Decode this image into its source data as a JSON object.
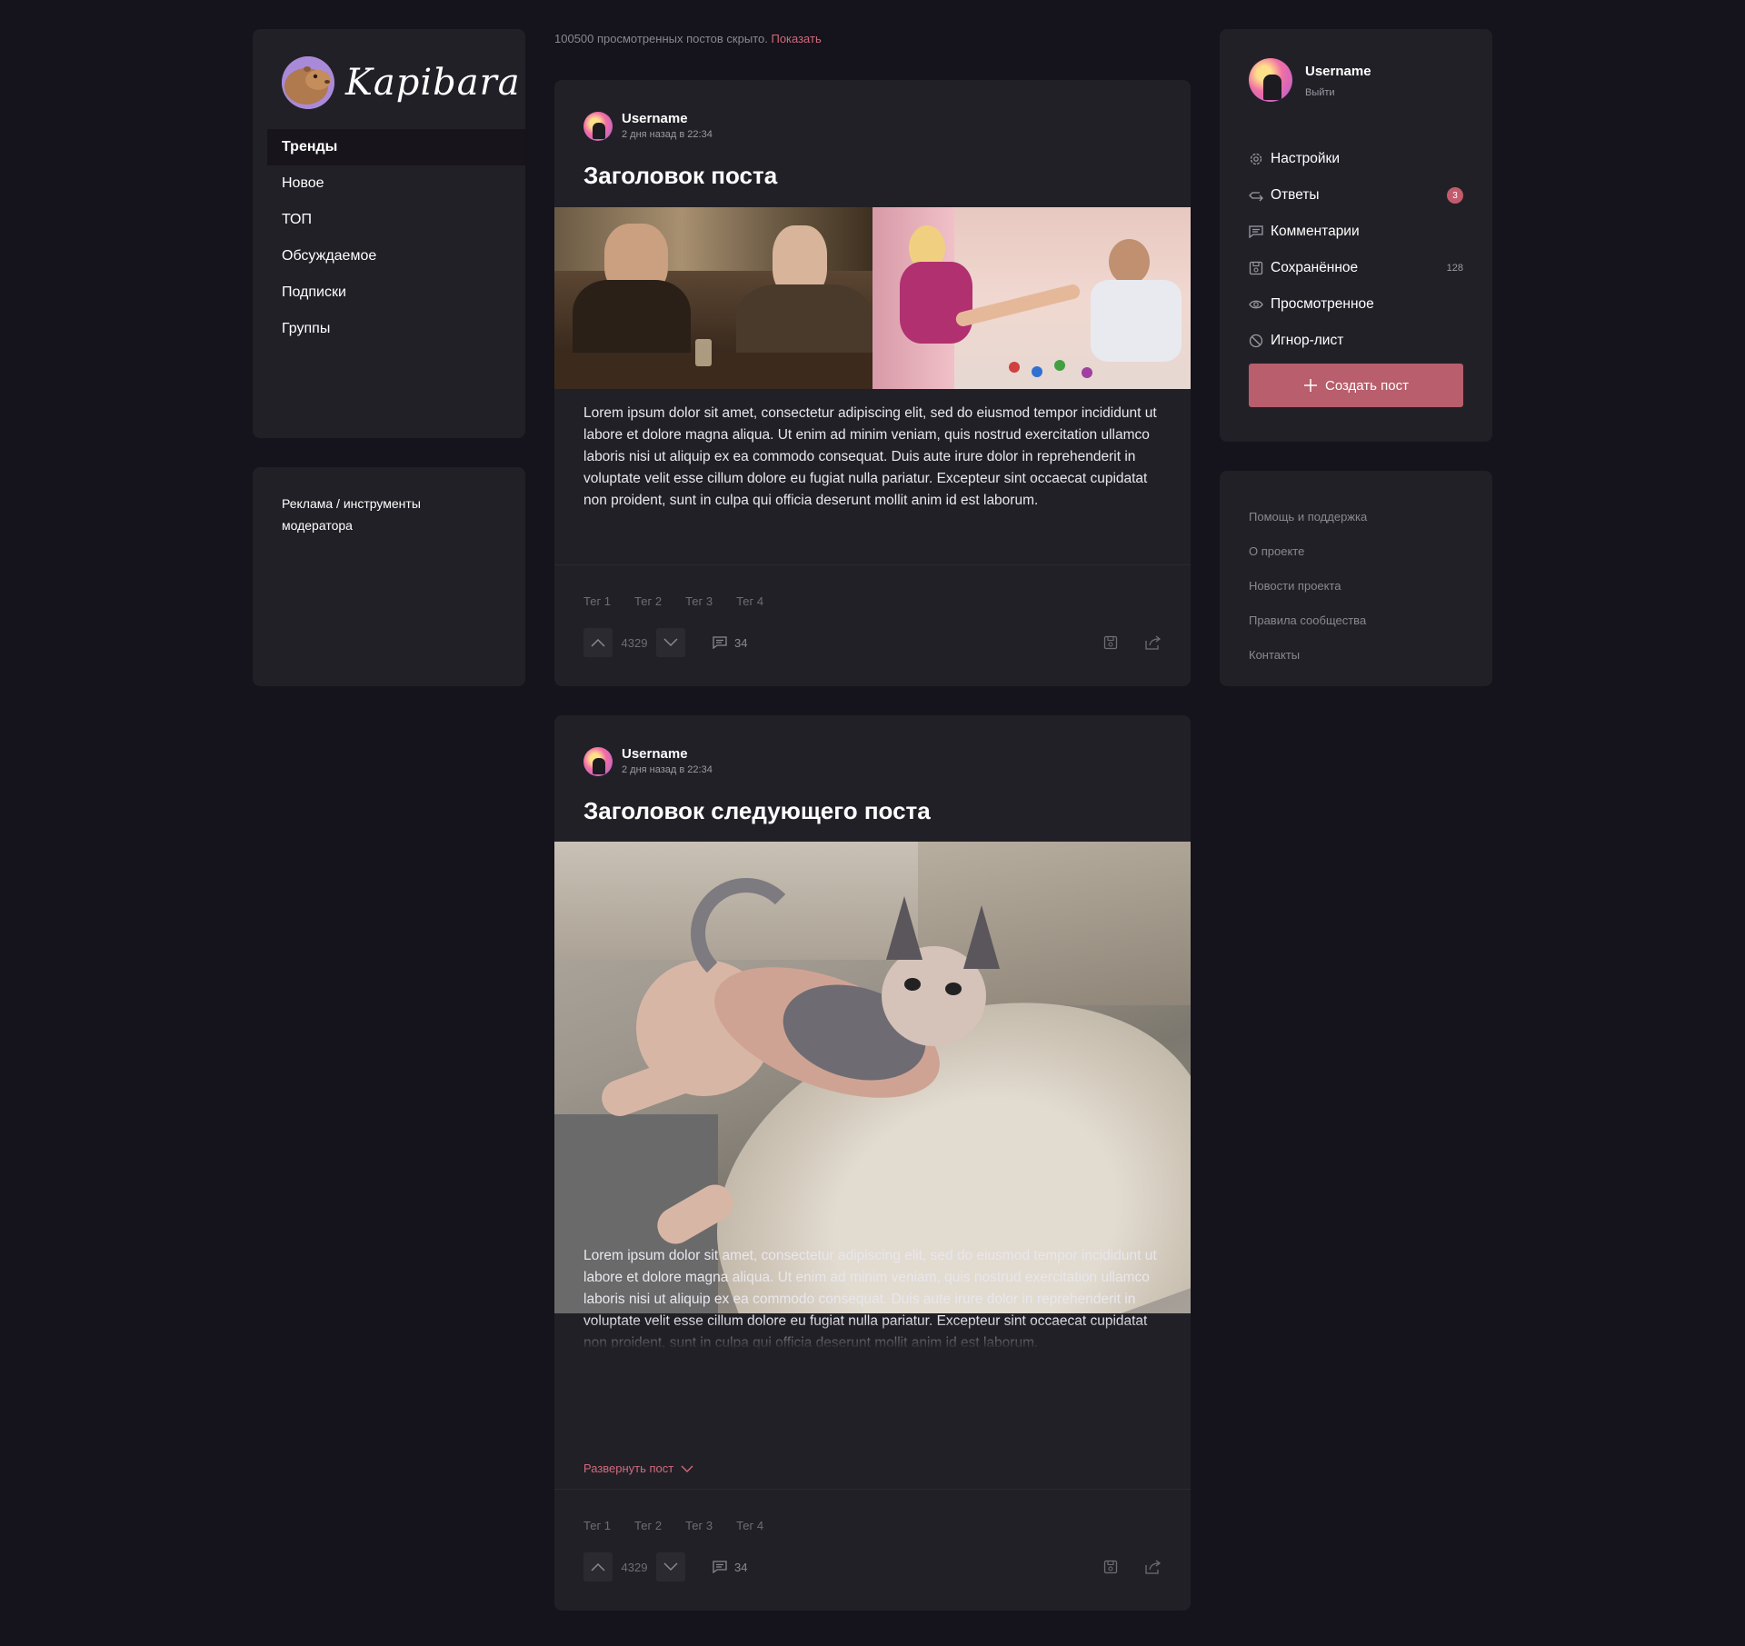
{
  "brand": {
    "name": "Kapibara"
  },
  "nav": {
    "items": [
      {
        "label": "Тренды"
      },
      {
        "label": "Новое"
      },
      {
        "label": "ТОП"
      },
      {
        "label": "Обсуждаемое"
      },
      {
        "label": "Подписки"
      },
      {
        "label": "Группы"
      }
    ],
    "active_label": "Тренды"
  },
  "ad": {
    "text": "Реклама / инструменты модератора"
  },
  "hidden_notice": {
    "text": "100500 просмотренных постов скрыто.",
    "link": "Показать"
  },
  "posts": [
    {
      "author": "Username",
      "date": "2 дня назад в 22:34",
      "title": "Заголовок поста",
      "body": "Lorem ipsum dolor sit amet, consectetur adipiscing elit, sed do eiusmod tempor incididunt ut labore et dolore magna aliqua. Ut enim ad minim veniam, quis nostrud exercitation ullamco laboris nisi ut aliquip ex ea commodo consequat. Duis aute irure dolor in reprehenderit in voluptate velit esse cillum dolore eu fugiat nulla pariatur. Excepteur sint occaecat cupidatat non proident, sunt in culpa qui officia deserunt mollit anim id est laborum.",
      "tags": [
        "Тег 1",
        "Тег 2",
        "Тег 3",
        "Тег 4"
      ],
      "score": "4329",
      "comments": "34"
    },
    {
      "author": "Username",
      "date": "2 дня назад в 22:34",
      "title": "Заголовок следующего поста",
      "body": "Lorem ipsum dolor sit amet, consectetur adipiscing elit, sed do eiusmod tempor incididunt ut labore et dolore magna aliqua. Ut enim ad minim veniam, quis nostrud exercitation ullamco laboris nisi ut aliquip ex ea commodo consequat. Duis aute irure dolor in reprehenderit in voluptate velit esse cillum dolore eu fugiat nulla pariatur. Excepteur sint occaecat cupidatat non proident, sunt in culpa qui officia deserunt mollit anim id est laborum.",
      "expand_label": "Развернуть пост",
      "tags": [
        "Тег 1",
        "Тег 2",
        "Тег 3",
        "Тег 4"
      ],
      "score": "4329",
      "comments": "34"
    }
  ],
  "user": {
    "name": "Username",
    "logout": "Выйти",
    "menu": [
      {
        "label": "Настройки",
        "icon": "gear-icon"
      },
      {
        "label": "Ответы",
        "icon": "reply-icon",
        "badge": "3"
      },
      {
        "label": "Комментарии",
        "icon": "comment-icon"
      },
      {
        "label": "Сохранённое",
        "icon": "save-icon",
        "count": "128"
      },
      {
        "label": "Просмотренное",
        "icon": "eye-icon"
      },
      {
        "label": "Игнор-лист",
        "icon": "block-icon"
      }
    ],
    "create_post": "Создать пост"
  },
  "footer_links": [
    "Помощь и поддержка",
    "О проекте",
    "Новости проекта",
    "Правила сообщества",
    "Контакты"
  ],
  "colors": {
    "background": "#15131b",
    "card": "#222027",
    "accent": "#b85e6c",
    "link": "#d06a7a"
  }
}
